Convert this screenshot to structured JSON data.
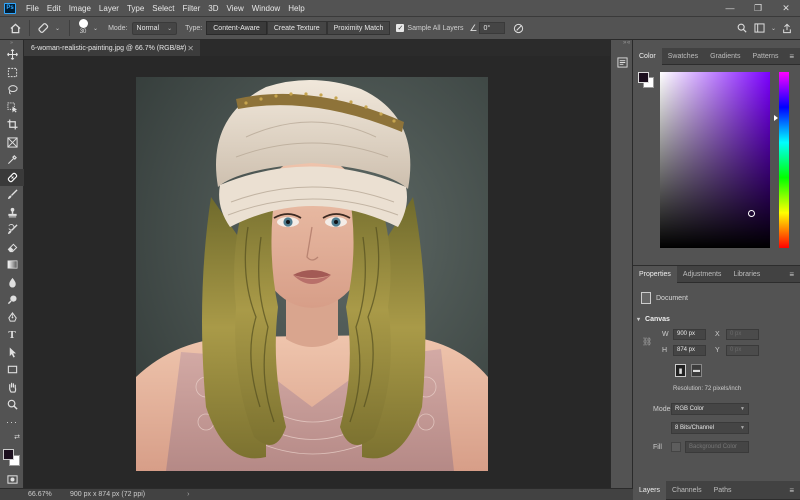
{
  "app": {
    "logo": "Ps"
  },
  "menu": [
    "File",
    "Edit",
    "Image",
    "Layer",
    "Type",
    "Select",
    "Filter",
    "3D",
    "View",
    "Window",
    "Help"
  ],
  "window_controls": {
    "minimize": "—",
    "maximize": "❐",
    "close": "✕"
  },
  "options": {
    "brush_size": "30",
    "mode_label": "Mode:",
    "mode_value": "Normal",
    "type_label": "Type:",
    "type_options": [
      "Content-Aware",
      "Create Texture",
      "Proximity Match"
    ],
    "sample_all_layers": "Sample All Layers",
    "angle": "0°"
  },
  "document": {
    "tab_title": "6-woman-realistic-painting.jpg @ 66.7% (RGB/8#)",
    "tab_close": "✕"
  },
  "status": {
    "zoom": "66.67%",
    "info": "900 px x 874 px (72 ppi)",
    "arrow": "›"
  },
  "panels": {
    "color_tabs": [
      "Color",
      "Swatches",
      "Gradients",
      "Patterns"
    ],
    "props_tabs": [
      "Properties",
      "Adjustments",
      "Libraries"
    ],
    "layers_tabs": [
      "Layers",
      "Channels",
      "Paths"
    ],
    "menu_icon": "≡",
    "foreground_color": "#1c0f1e",
    "background_color": "#ffffff",
    "picker_hue_color": "#7b00ff"
  },
  "properties": {
    "document_label": "Document",
    "canvas_title": "Canvas",
    "w_label": "W",
    "w_value": "900 px",
    "h_label": "H",
    "h_value": "874 px",
    "x_label": "X",
    "x_value": "0 px",
    "y_label": "Y",
    "y_value": "0 px",
    "resolution": "Resolution: 72 pixels/inch",
    "mode_label": "Mode",
    "mode_value": "RGB Color",
    "depth_value": "8 Bits/Channel",
    "fill_label": "Fill",
    "fill_value": "Background Color"
  }
}
